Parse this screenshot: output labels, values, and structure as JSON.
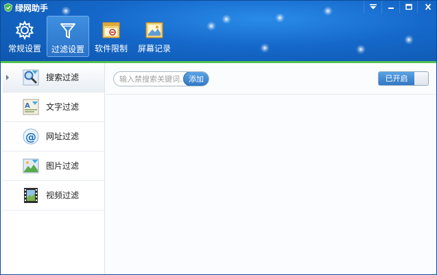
{
  "app": {
    "title": "绿网助手"
  },
  "toolbar": {
    "items": [
      {
        "label": "常规设置",
        "icon": "gear-icon"
      },
      {
        "label": "过滤设置",
        "icon": "filter-icon"
      },
      {
        "label": "软件限制",
        "icon": "app-window-icon"
      },
      {
        "label": "屏幕记录",
        "icon": "screenshot-icon"
      }
    ],
    "active_index": 1
  },
  "sidebar": {
    "items": [
      {
        "label": "搜索过滤",
        "icon": "search-filter-icon"
      },
      {
        "label": "文字过滤",
        "icon": "text-filter-icon"
      },
      {
        "label": "网址过滤",
        "icon": "url-filter-icon"
      },
      {
        "label": "图片过滤",
        "icon": "image-filter-icon"
      },
      {
        "label": "视频过滤",
        "icon": "video-filter-icon"
      }
    ],
    "active_index": 0
  },
  "search_filter": {
    "placeholder": "输入禁搜索关键词...",
    "add_label": "添加",
    "toggle_label": "已开启"
  },
  "colors": {
    "accent": "#1566c4",
    "green_line": "#4fc14f",
    "button_blue": "#3277c4"
  }
}
